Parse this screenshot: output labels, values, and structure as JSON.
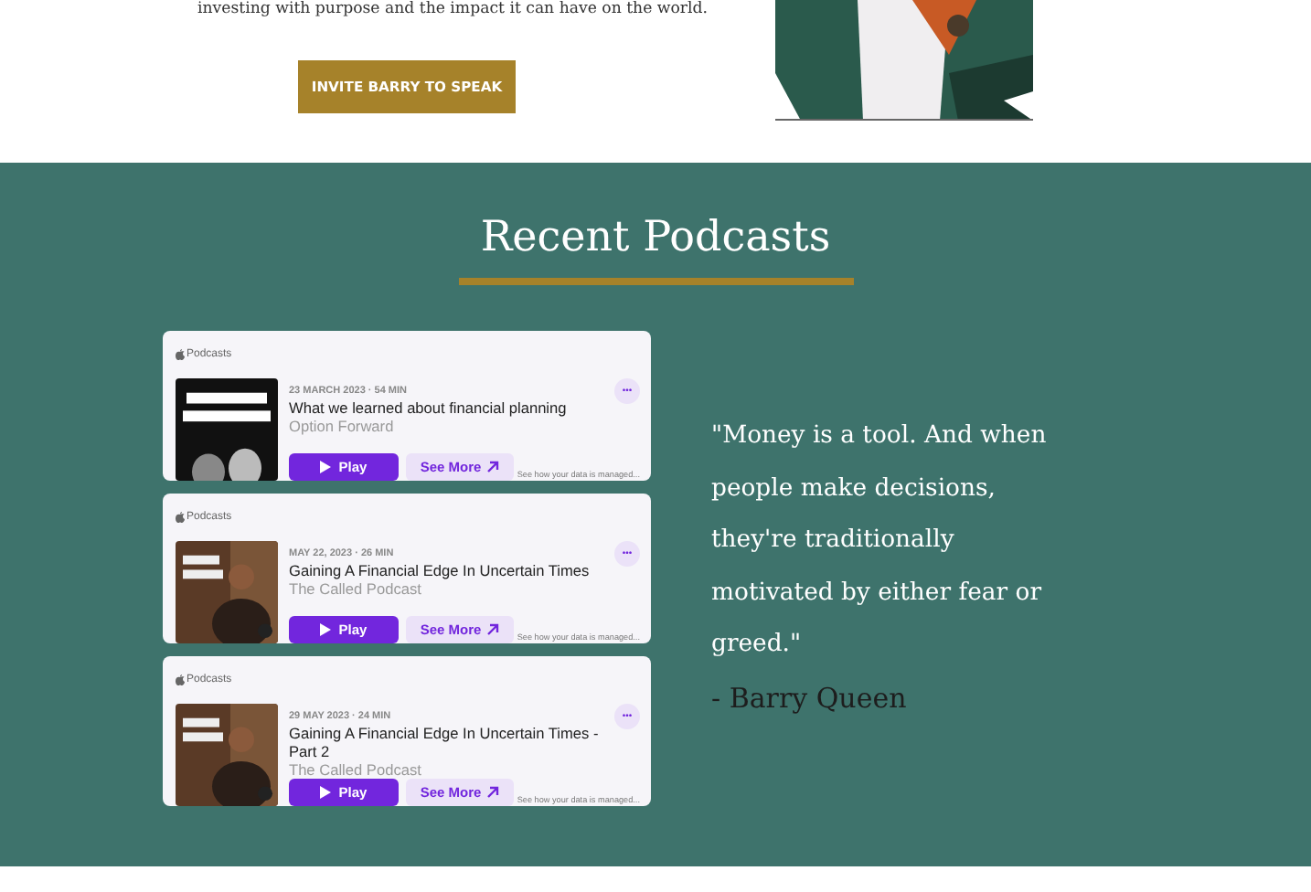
{
  "intro": {
    "text": "investing with purpose and the impact it can have on the world.",
    "button": "INVITE BARRY TO SPEAK"
  },
  "podcasts": {
    "title": "Recent Podcasts",
    "episodes": [
      {
        "source": "Podcasts",
        "meta": "23 MARCH 2023 · 54 MIN",
        "title": "What we learned about financial planning",
        "show": "Option Forward",
        "play": "Play",
        "more": "See More",
        "menu": "•••",
        "note": "See how your data is managed..."
      },
      {
        "source": "Podcasts",
        "meta": "MAY 22, 2023 · 26 MIN",
        "title": "Gaining A Financial Edge In Uncertain Times",
        "show": "The Called Podcast",
        "play": "Play",
        "more": "See More",
        "menu": "•••",
        "note": "See how your data is managed..."
      },
      {
        "source": "Podcasts",
        "meta": "29 MAY 2023 · 24 MIN",
        "title": "Gaining A Financial Edge In Uncertain Times - Part 2",
        "show": "The Called Podcast",
        "play": "Play",
        "more": "See More",
        "menu": "•••",
        "note": "See how your data is managed..."
      }
    ],
    "quote": "\"Money is a tool. And when people make decisions, they're traditionally motivated by either fear or greed.\"",
    "author": "- Barry Queen"
  }
}
